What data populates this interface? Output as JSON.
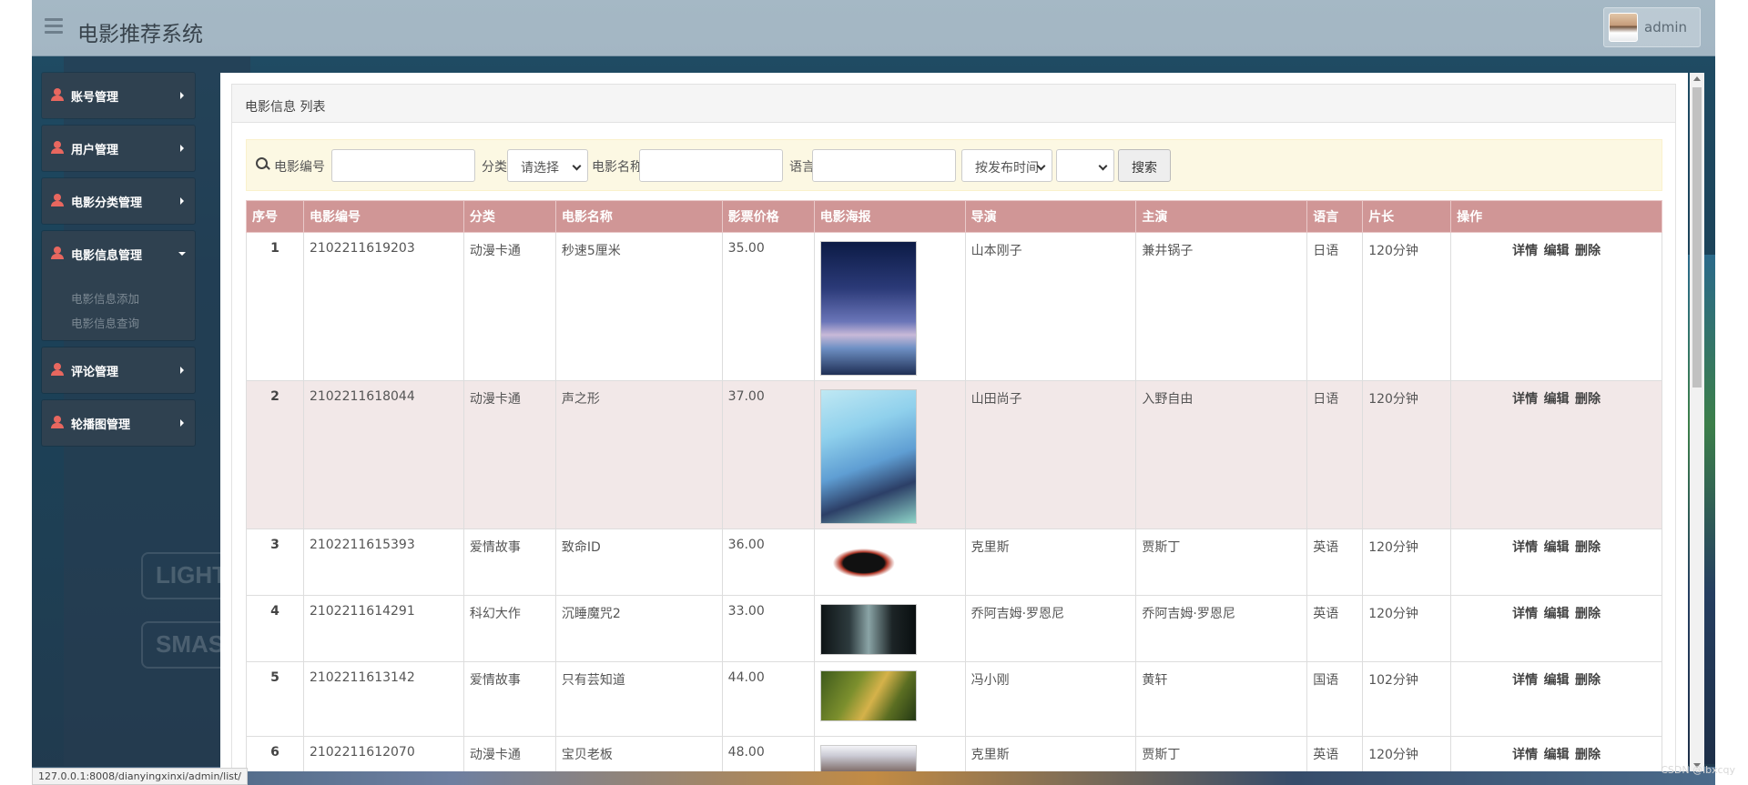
{
  "app": {
    "title": "电影推荐系统",
    "user": "admin",
    "status_url": "127.0.0.1:8008/dianyingxinxi/admin/list/",
    "watermark": "CSDN @lbxcqy"
  },
  "sidebar": {
    "items": [
      {
        "label": "账号管理"
      },
      {
        "label": "用户管理"
      },
      {
        "label": "电影分类管理"
      },
      {
        "label": "电影信息管理",
        "children": [
          "电影信息添加",
          "电影信息查询"
        ]
      },
      {
        "label": "评论管理"
      },
      {
        "label": "轮播图管理"
      }
    ]
  },
  "panel": {
    "title": "电影信息 列表"
  },
  "search": {
    "label_id": "电影编号",
    "label_category": "分类",
    "category_value": "请选择",
    "label_name": "电影名称",
    "label_language": "语言",
    "sort_value": "按发布时间",
    "order_value": "",
    "button": "搜索"
  },
  "table": {
    "headers": [
      "序号",
      "电影编号",
      "分类",
      "电影名称",
      "影票价格",
      "电影海报",
      "导演",
      "主演",
      "语言",
      "片长",
      "操作"
    ],
    "ops": [
      "详情",
      "编辑",
      "删除"
    ],
    "rows": [
      {
        "idx": "1",
        "id": "2102211619203",
        "cat": "动漫卡通",
        "name": "秒速5厘米",
        "price": "35.00",
        "director": "山本刚子",
        "star": "兼井锅子",
        "lang": "日语",
        "len": "120分钟"
      },
      {
        "idx": "2",
        "id": "2102211618044",
        "cat": "动漫卡通",
        "name": "声之形",
        "price": "37.00",
        "director": "山田尚子",
        "star": "入野自由",
        "lang": "日语",
        "len": "120分钟"
      },
      {
        "idx": "3",
        "id": "2102211615393",
        "cat": "爱情故事",
        "name": "致命ID",
        "price": "36.00",
        "director": "克里斯",
        "star": "贾斯丁",
        "lang": "英语",
        "len": "120分钟"
      },
      {
        "idx": "4",
        "id": "2102211614291",
        "cat": "科幻大作",
        "name": "沉睡魔咒2",
        "price": "33.00",
        "director": "乔阿吉姆·罗恩尼",
        "star": "乔阿吉姆·罗恩尼",
        "lang": "英语",
        "len": "120分钟"
      },
      {
        "idx": "5",
        "id": "2102211613142",
        "cat": "爱情故事",
        "name": "只有芸知道",
        "price": "44.00",
        "director": "冯小刚",
        "star": "黄轩",
        "lang": "国语",
        "len": "102分钟"
      },
      {
        "idx": "6",
        "id": "2102211612070",
        "cat": "动漫卡通",
        "name": "宝贝老板",
        "price": "48.00",
        "director": "克里斯",
        "star": "贾斯丁",
        "lang": "英语",
        "len": "120分钟"
      }
    ]
  }
}
